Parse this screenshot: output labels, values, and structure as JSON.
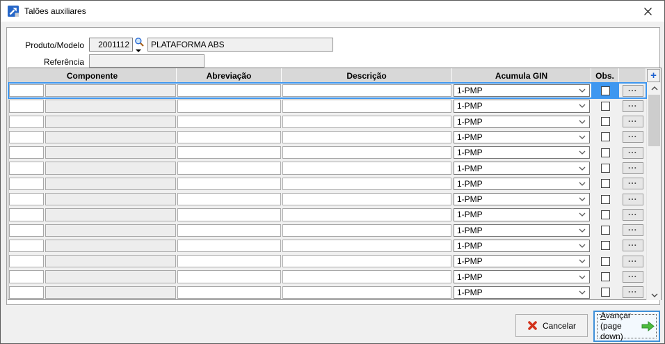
{
  "window": {
    "title": "Talões auxiliares"
  },
  "icons": {
    "app_icon": "blue-arrow-chart",
    "close": "x",
    "lookup": "magnifier",
    "cancel": "red-x",
    "advance": "green-right-arrow",
    "plus": "+",
    "scroll_up": "chevron-up",
    "scroll_down": "chevron-down"
  },
  "form": {
    "produto_label": "Produto/Modelo",
    "produto_code": "2001112",
    "produto_name": "PLATAFORMA ABS",
    "referencia_label": "Referência",
    "referencia_value": ""
  },
  "grid": {
    "columns": [
      "Componente",
      "Abreviação",
      "Descrição",
      "Acumula GIN",
      "Obs.",
      ""
    ],
    "add_button_label": "+",
    "detail_button_label": "...",
    "selected_row": 0,
    "rows": [
      {
        "componente": "",
        "abreviacao": "",
        "descricao": "",
        "acumula_gin": "1-PMP",
        "obs": false
      },
      {
        "componente": "",
        "abreviacao": "",
        "descricao": "",
        "acumula_gin": "1-PMP",
        "obs": false
      },
      {
        "componente": "",
        "abreviacao": "",
        "descricao": "",
        "acumula_gin": "1-PMP",
        "obs": false
      },
      {
        "componente": "",
        "abreviacao": "",
        "descricao": "",
        "acumula_gin": "1-PMP",
        "obs": false
      },
      {
        "componente": "",
        "abreviacao": "",
        "descricao": "",
        "acumula_gin": "1-PMP",
        "obs": false
      },
      {
        "componente": "",
        "abreviacao": "",
        "descricao": "",
        "acumula_gin": "1-PMP",
        "obs": false
      },
      {
        "componente": "",
        "abreviacao": "",
        "descricao": "",
        "acumula_gin": "1-PMP",
        "obs": false
      },
      {
        "componente": "",
        "abreviacao": "",
        "descricao": "",
        "acumula_gin": "1-PMP",
        "obs": false
      },
      {
        "componente": "",
        "abreviacao": "",
        "descricao": "",
        "acumula_gin": "1-PMP",
        "obs": false
      },
      {
        "componente": "",
        "abreviacao": "",
        "descricao": "",
        "acumula_gin": "1-PMP",
        "obs": false
      },
      {
        "componente": "",
        "abreviacao": "",
        "descricao": "",
        "acumula_gin": "1-PMP",
        "obs": false
      },
      {
        "componente": "",
        "abreviacao": "",
        "descricao": "",
        "acumula_gin": "1-PMP",
        "obs": false
      },
      {
        "componente": "",
        "abreviacao": "",
        "descricao": "",
        "acumula_gin": "1-PMP",
        "obs": false
      },
      {
        "componente": "",
        "abreviacao": "",
        "descricao": "",
        "acumula_gin": "1-PMP",
        "obs": false
      }
    ]
  },
  "footer": {
    "cancel_label": "Cancelar",
    "advance_label": "Avançar",
    "advance_sub": "(page down)"
  },
  "colors": {
    "selection_blue": "#3E97F0",
    "focus_border": "#3E8FD8",
    "cancel_icon_red": "#D2331C",
    "advance_icon_green": "#4CBB3C",
    "plus_icon_blue": "#1E62D0",
    "header_bg": "#D8D8D8"
  }
}
